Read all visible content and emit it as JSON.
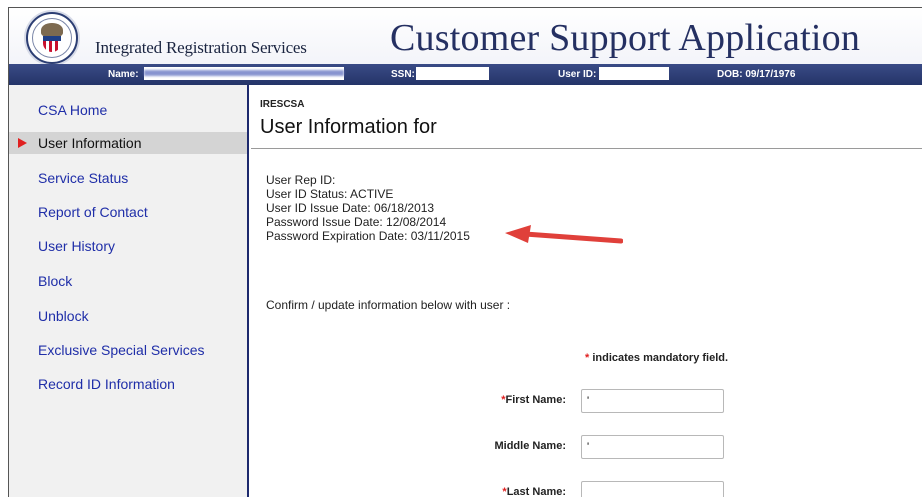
{
  "header": {
    "org_name": "Integrated Registration Services",
    "app_title": "Customer Support Application",
    "info_bar": {
      "name_label": "Name:",
      "ssn_label": "SSN:",
      "user_id_label": "User ID:",
      "dob_label": "DOB: 09/17/1976"
    }
  },
  "sidebar": {
    "items": [
      {
        "label": "CSA Home"
      },
      {
        "label": "User Information"
      },
      {
        "label": "Service Status"
      },
      {
        "label": "Report of Contact"
      },
      {
        "label": "User History"
      },
      {
        "label": "Block"
      },
      {
        "label": "Unblock"
      },
      {
        "label": "Exclusive Special Services"
      },
      {
        "label": "Record ID Information"
      }
    ],
    "active_index": 1
  },
  "main": {
    "breadcrumb": "IRESCSA",
    "title": "User Information for",
    "info": {
      "rep_id": "User Rep ID:",
      "status": "User ID Status: ACTIVE",
      "issue_date": "User ID Issue Date: 06/18/2013",
      "password_issue": "Password Issue Date: 12/08/2014",
      "password_expiration": "Password Expiration Date: 03/11/2015"
    },
    "confirm_text": "Confirm / update information below with user :",
    "mandatory_note": "indicates mandatory field.",
    "form": {
      "first_name_label": "First Name:",
      "middle_name_label": "Middle Name:",
      "last_name_label": "Last Name:",
      "first_name_value": "'",
      "middle_name_value": "'",
      "last_name_value": ""
    }
  },
  "colors": {
    "header_bar": "#2c3d78",
    "nav_link": "#1f2ea8",
    "active_nav_bg": "#d4d4d4",
    "accent_red": "#e02020",
    "sidebar_border": "#1e2a6e"
  },
  "icons": [
    "agency-seal-icon",
    "active-arrow-icon",
    "callout-arrow-icon",
    "required-asterisk-icon"
  ]
}
